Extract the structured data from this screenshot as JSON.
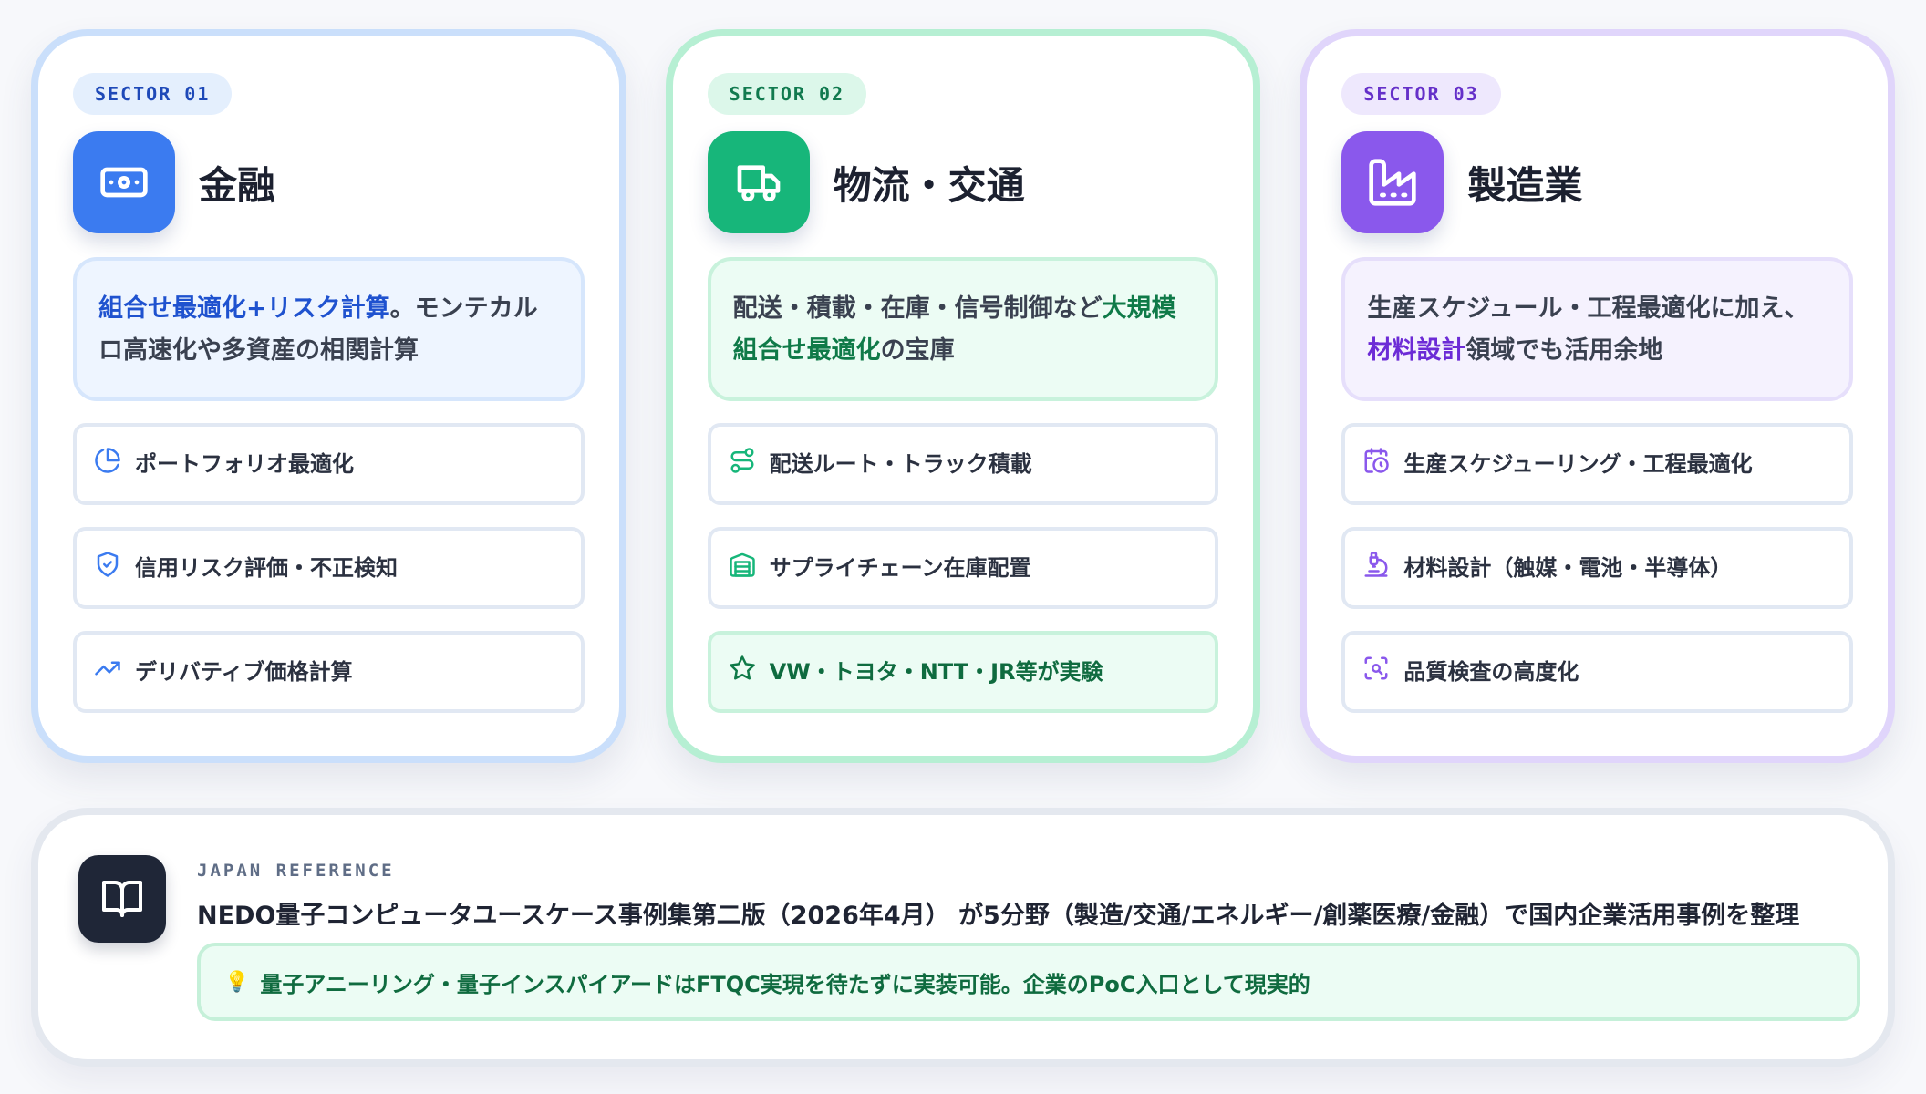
{
  "sectors": [
    {
      "badge": "SECTOR 01",
      "title": "金融",
      "icon": "banknote-icon",
      "desc": {
        "highlight": "組合せ最適化+リスク計算",
        "rest": "。モンテカルロ高速化や多資産の相関計算"
      },
      "items": [
        {
          "icon": "pie-chart-icon",
          "label": "ポートフォリオ最適化"
        },
        {
          "icon": "shield-check-icon",
          "label": "信用リスク評価・不正検知"
        },
        {
          "icon": "trending-up-icon",
          "label": "デリバティブ価格計算"
        }
      ]
    },
    {
      "badge": "SECTOR 02",
      "title": "物流・交通",
      "icon": "truck-icon",
      "desc": {
        "prefix": "配送・積載・在庫・信号制御など",
        "highlight": "大規模組合せ最適化",
        "rest": "の宝庫"
      },
      "items": [
        {
          "icon": "route-icon",
          "label": "配送ルート・トラック積載"
        },
        {
          "icon": "warehouse-icon",
          "label": "サプライチェーン在庫配置"
        },
        {
          "icon": "star-icon",
          "label": "VW・トヨタ・NTT・JR等が実験"
        }
      ]
    },
    {
      "badge": "SECTOR 03",
      "title": "製造業",
      "icon": "factory-icon",
      "desc": {
        "prefix": "生産スケジュール・工程最適化に加え、",
        "highlight": "材料設計",
        "rest": "領域でも活用余地"
      },
      "items": [
        {
          "icon": "calendar-clock-icon",
          "label": "生産スケジューリング・工程最適化"
        },
        {
          "icon": "microscope-icon",
          "label": "材料設計（触媒・電池・半導体）"
        },
        {
          "icon": "scan-search-icon",
          "label": "品質検査の高度化"
        }
      ]
    }
  ],
  "reference": {
    "icon": "book-open-icon",
    "kicker": "JAPAN REFERENCE",
    "text": "NEDO量子コンピュータユースケース事例集第二版（2026年4月） が5分野（製造/交通/エネルギー/創薬医療/金融）で国内企業活用事例を整理",
    "note_icon": "lightbulb-icon",
    "note": "量子アニーリング・量子インスパイアードはFTQC実現を待たずに実装可能。企業のPoC入口として現実的"
  }
}
